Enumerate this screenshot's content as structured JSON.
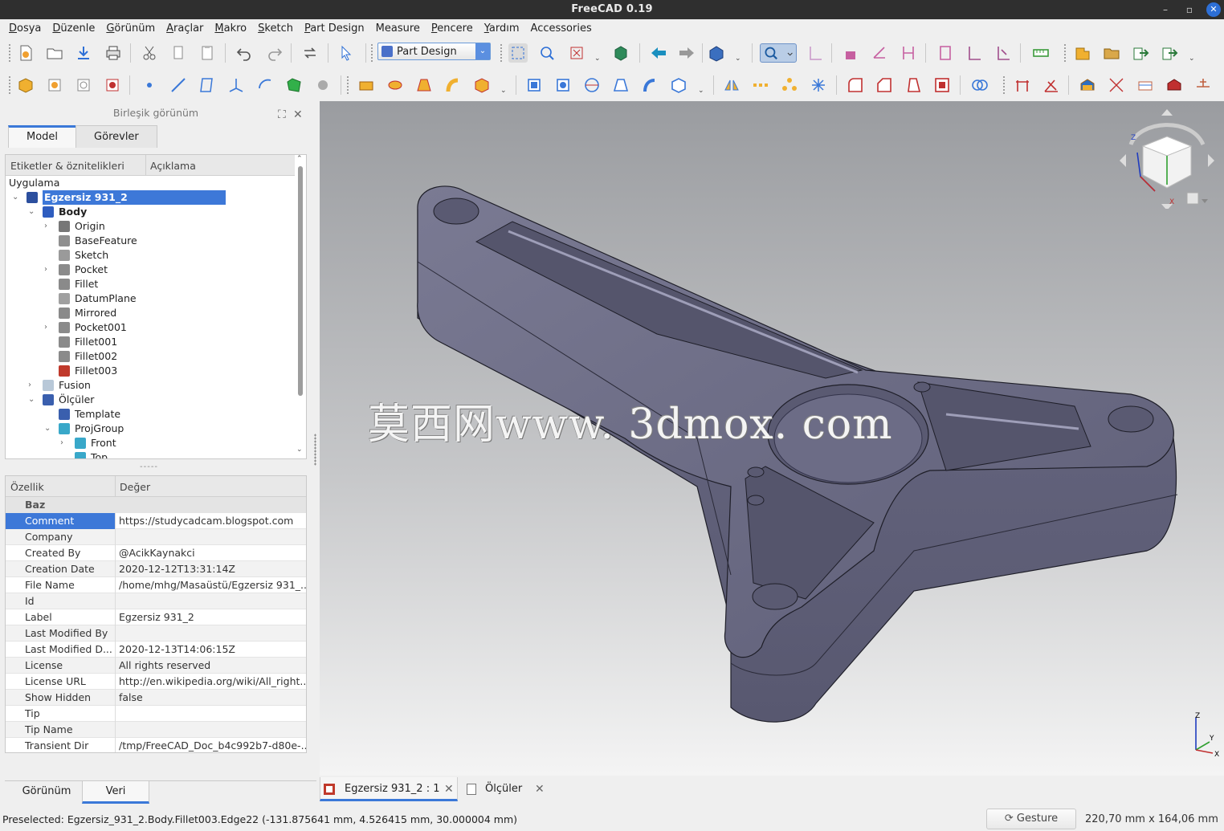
{
  "window": {
    "title": "FreeCAD 0.19",
    "minimize": "–",
    "maximize": "▫",
    "close": "✕"
  },
  "menus": [
    {
      "underline": "D",
      "rest": "osya"
    },
    {
      "underline": "D",
      "rest": "üzenle"
    },
    {
      "underline": "G",
      "rest": "örünüm"
    },
    {
      "underline": "A",
      "rest": "raçlar"
    },
    {
      "underline": "M",
      "rest": "akro"
    },
    {
      "underline": "S",
      "rest": "ketch"
    },
    {
      "underline": "P",
      "rest": "art Design"
    },
    {
      "underline": "",
      "rest": "Measure"
    },
    {
      "underline": "P",
      "rest": "encere"
    },
    {
      "underline": "Y",
      "rest": "ardım"
    },
    {
      "underline": "",
      "rest": "Accessories"
    }
  ],
  "toolbar": {
    "workbench": "Part Design",
    "dropdown_arrow": "⌄"
  },
  "combo_view": {
    "title": "Birleşik görünüm",
    "float_icon": "⛶",
    "close_icon": "✕",
    "tabs": [
      "Model",
      "Görevler"
    ],
    "tree_columns": [
      "Etiketler & öznitelikleri",
      "Açıklama"
    ],
    "tree": [
      {
        "label": "Uygulama",
        "depth": 0,
        "expander": "",
        "icon": "",
        "color": ""
      },
      {
        "label": "Egzersiz 931_2",
        "depth": 1,
        "expander": "⌄",
        "icon": "doc-icon",
        "color": "#2c4f9e",
        "selected": true
      },
      {
        "label": "Body",
        "depth": 2,
        "expander": "⌄",
        "icon": "body-icon",
        "color": "#2e5dbf",
        "bold": true
      },
      {
        "label": "Origin",
        "depth": 3,
        "expander": "›",
        "icon": "origin-icon",
        "color": "#777777"
      },
      {
        "label": "BaseFeature",
        "depth": 3,
        "expander": "",
        "icon": "feature-icon",
        "color": "#8f8f8f"
      },
      {
        "label": "Sketch",
        "depth": 3,
        "expander": "",
        "icon": "sketch-icon",
        "color": "#9a9a9a"
      },
      {
        "label": "Pocket",
        "depth": 3,
        "expander": "›",
        "icon": "pocket-icon",
        "color": "#8a8a8a"
      },
      {
        "label": "Fillet",
        "depth": 3,
        "expander": "",
        "icon": "fillet-icon",
        "color": "#8a8a8a"
      },
      {
        "label": "DatumPlane",
        "depth": 3,
        "expander": "",
        "icon": "datum-plane-icon",
        "color": "#a0a0a0"
      },
      {
        "label": "Mirrored",
        "depth": 3,
        "expander": "",
        "icon": "mirrored-icon",
        "color": "#8a8a8a"
      },
      {
        "label": "Pocket001",
        "depth": 3,
        "expander": "›",
        "icon": "pocket-icon",
        "color": "#8a8a8a"
      },
      {
        "label": "Fillet001",
        "depth": 3,
        "expander": "",
        "icon": "fillet-icon",
        "color": "#8a8a8a"
      },
      {
        "label": "Fillet002",
        "depth": 3,
        "expander": "",
        "icon": "fillet-icon",
        "color": "#8a8a8a"
      },
      {
        "label": "Fillet003",
        "depth": 3,
        "expander": "",
        "icon": "fillet-tip-icon",
        "color": "#c0392b"
      },
      {
        "label": "Fusion",
        "depth": 2,
        "expander": "›",
        "icon": "fusion-icon",
        "color": "#b8c8d8"
      },
      {
        "label": "Ölçüler",
        "depth": 2,
        "expander": "⌄",
        "icon": "page-icon",
        "color": "#3a5fae"
      },
      {
        "label": "Template",
        "depth": 3,
        "expander": "",
        "icon": "template-icon",
        "color": "#3a5fae"
      },
      {
        "label": "ProjGroup",
        "depth": 3,
        "expander": "⌄",
        "icon": "projgroup-icon",
        "color": "#39a8c9"
      },
      {
        "label": "Front",
        "depth": 4,
        "expander": "›",
        "icon": "view-icon",
        "color": "#39a8c9"
      },
      {
        "label": "Top",
        "depth": 4,
        "expander": "",
        "icon": "view-icon",
        "color": "#39a8c9"
      }
    ],
    "splitter_label": "-----",
    "prop_columns": [
      "Özellik",
      "Değer"
    ],
    "properties": [
      {
        "key": "Baz",
        "value": "",
        "group": true
      },
      {
        "key": "Comment",
        "value": "https://studycadcam.blogspot.com",
        "selected": true
      },
      {
        "key": "Company",
        "value": ""
      },
      {
        "key": "Created By",
        "value": "@AcikKaynakci"
      },
      {
        "key": "Creation Date",
        "value": "2020-12-12T13:31:14Z"
      },
      {
        "key": "File Name",
        "value": "/home/mhg/Masaüstü/Egzersiz 931_..."
      },
      {
        "key": "Id",
        "value": ""
      },
      {
        "key": "Label",
        "value": "Egzersiz 931_2"
      },
      {
        "key": "Last Modified By",
        "value": ""
      },
      {
        "key": "Last Modified D...",
        "value": "2020-12-13T14:06:15Z"
      },
      {
        "key": "License",
        "value": "All rights reserved"
      },
      {
        "key": "License URL",
        "value": "http://en.wikipedia.org/wiki/All_right..."
      },
      {
        "key": "Show Hidden",
        "value": "false"
      },
      {
        "key": "Tip",
        "value": ""
      },
      {
        "key": "Tip Name",
        "value": ""
      },
      {
        "key": "Transient Dir",
        "value": "/tmp/FreeCAD_Doc_b4c992b7-d80e-..."
      }
    ],
    "bottom_tabs": [
      "Görünüm",
      "Veri"
    ]
  },
  "view3d": {
    "watermark": "莫西网www. 3dmox. com",
    "navcube": {
      "x": "X",
      "y": "Y",
      "z": "Z"
    },
    "axis": {
      "x": "X",
      "y": "Y",
      "z": "Z"
    }
  },
  "doc_tabs": [
    {
      "label": "Egzersiz 931_2 : 1",
      "close": "✕",
      "active": true
    },
    {
      "label": "Ölçüler",
      "close": "✕",
      "active": false
    }
  ],
  "statusbar": {
    "message": "Preselected: Egzersiz_931_2.Body.Fillet003.Edge22 (-131.875641 mm, 4.526415 mm, 30.000004 mm)",
    "nav_style": "Gesture",
    "dimensions": "220,70 mm x 164,06 mm"
  },
  "colors": {
    "accent": "#3d78d8",
    "part": "#6d6d86",
    "titlebar": "#2f2f2f"
  }
}
